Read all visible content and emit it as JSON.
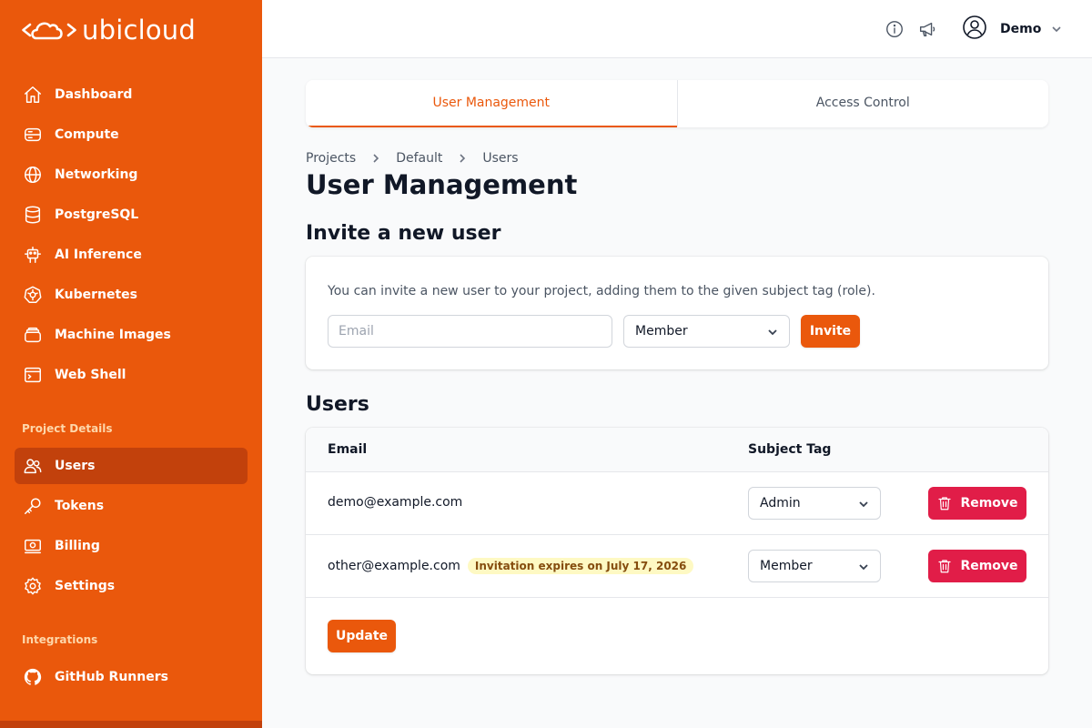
{
  "brand": {
    "name": "ubicloud"
  },
  "sidebar": {
    "items": [
      {
        "label": "Dashboard",
        "icon": "home-icon"
      },
      {
        "label": "Compute",
        "icon": "server-icon"
      },
      {
        "label": "Networking",
        "icon": "globe-icon"
      },
      {
        "label": "PostgreSQL",
        "icon": "database-icon"
      },
      {
        "label": "AI Inference",
        "icon": "robot-icon"
      },
      {
        "label": "Kubernetes",
        "icon": "kubernetes-icon"
      },
      {
        "label": "Machine Images",
        "icon": "stack-icon"
      },
      {
        "label": "Web Shell",
        "icon": "terminal-icon"
      }
    ],
    "project_section_title": "Project Details",
    "project_items": [
      {
        "label": "Users",
        "icon": "users-icon",
        "active": true
      },
      {
        "label": "Tokens",
        "icon": "key-icon"
      },
      {
        "label": "Billing",
        "icon": "banknote-icon"
      },
      {
        "label": "Settings",
        "icon": "gear-icon"
      }
    ],
    "integrations_title": "Integrations",
    "integration_items": [
      {
        "label": "GitHub Runners",
        "icon": "github-icon"
      }
    ]
  },
  "header": {
    "user_name": "Demo",
    "icons": [
      "info-icon",
      "megaphone-icon",
      "user-circle-icon",
      "chevron-down-icon"
    ]
  },
  "tabs": [
    {
      "label": "User Management",
      "active": true
    },
    {
      "label": "Access Control",
      "active": false
    }
  ],
  "breadcrumb": [
    "Projects",
    "Default",
    "Users"
  ],
  "page_title": "User Management",
  "invite": {
    "heading": "Invite a new user",
    "description": "You can invite a new user to your project, adding them to the given subject tag (role).",
    "email_placeholder": "Email",
    "email_value": "",
    "role_selected": "Member",
    "invite_label": "Invite"
  },
  "users": {
    "heading": "Users",
    "columns": [
      "Email",
      "Subject Tag"
    ],
    "rows": [
      {
        "email": "demo@example.com",
        "badge": "",
        "tag": "Admin",
        "remove_label": "Remove"
      },
      {
        "email": "other@example.com",
        "badge": "Invitation expires on July 17, 2026",
        "tag": "Member",
        "remove_label": "Remove"
      }
    ],
    "update_label": "Update"
  },
  "colors": {
    "brand_orange": "#ea580c",
    "sidebar_active": "#c2410c",
    "danger_red": "#e11d48",
    "badge_bg": "#fef9c3",
    "badge_text": "#854d0e"
  }
}
